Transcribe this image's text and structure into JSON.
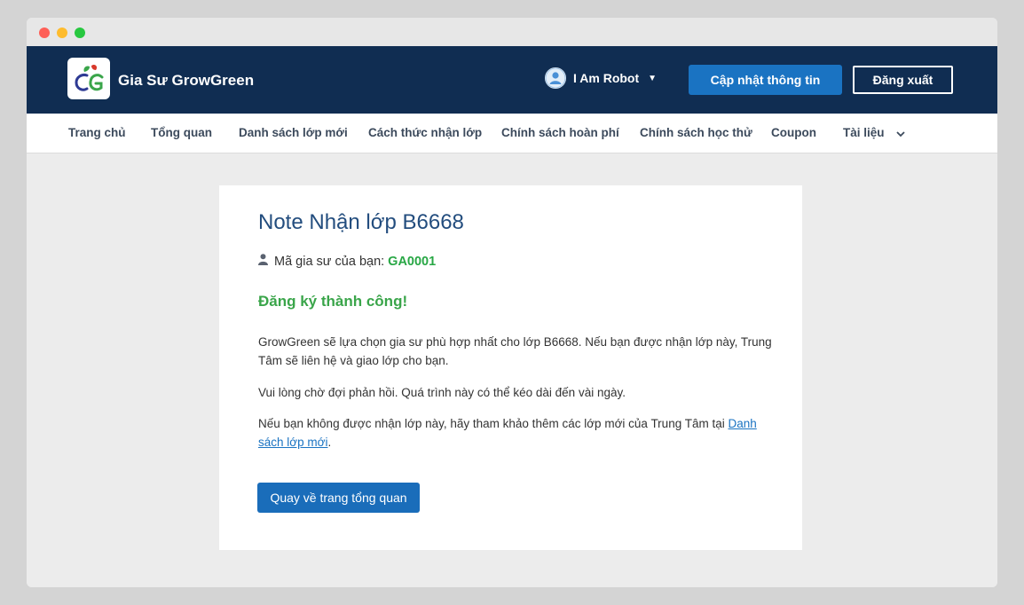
{
  "header": {
    "brand": "Gia Sư GrowGreen",
    "user_name": "I Am Robot",
    "update_button": "Cập nhật thông tin",
    "logout_button": "Đăng xuất"
  },
  "nav": {
    "items": [
      "Trang chủ",
      "Tổng quan",
      "Danh sách lớp mới",
      "Cách thức nhận lớp",
      "Chính sách hoàn phí",
      "Chính sách học thử",
      "Coupon",
      "Tài liệu"
    ]
  },
  "card": {
    "title": "Note Nhận lớp B6668",
    "tutor_code_label": "Mã gia sư của bạn:",
    "tutor_code": "GA0001",
    "success": "Đăng ký thành công!",
    "p1": "GrowGreen sẽ lựa chọn gia sư phù hợp nhất cho lớp B6668. Nếu bạn được nhận lớp này, Trung Tâm sẽ liên hệ và giao lớp cho bạn.",
    "p2": "Vui lòng chờ đợi phản hồi. Quá trình này có thể kéo dài đến vài ngày.",
    "p3_text": "Nếu bạn không được nhận lớp này, hãy tham khảo thêm các lớp mới của Trung Tâm tại",
    "p3_link": "Danh sách lớp mới",
    "p3_end": ".",
    "back_button": "Quay về trang tổng quan"
  },
  "colors": {
    "topbar": "#102d52",
    "accent": "#1a73c2",
    "success": "#3aa54a"
  }
}
